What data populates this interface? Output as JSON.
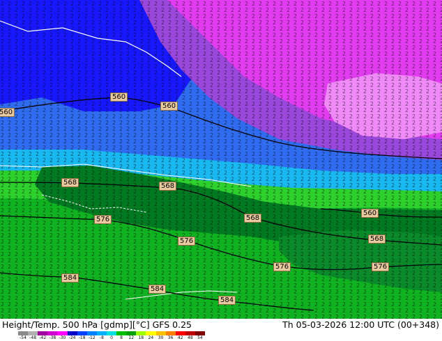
{
  "footer": {
    "title": "Height/Temp. 500 hPa [gdmp][°C] GFS 0.25",
    "datetime": "Th 05-03-2026 12:00 UTC (00+348)"
  },
  "colorbar": {
    "ticks": [
      "-54",
      "-48",
      "-42",
      "-38",
      "-30",
      "-24",
      "-18",
      "-12",
      "-8",
      "0",
      "8",
      "12",
      "18",
      "24",
      "30",
      "36",
      "42",
      "48",
      "54"
    ],
    "colors": [
      "#8a8a8a",
      "#b0b0b0",
      "#a000a0",
      "#d000d0",
      "#ff00ff",
      "#0000c8",
      "#0040ff",
      "#0080ff",
      "#00b0ff",
      "#00e0e0",
      "#00c000",
      "#00a000",
      "#a0ff00",
      "#ffff00",
      "#ffc000",
      "#ff8000",
      "#ff0000",
      "#c00000",
      "#800000"
    ]
  },
  "contour_labels": [
    "560",
    "560",
    "560",
    "568",
    "568",
    "576",
    "568",
    "568",
    "560",
    "576",
    "584",
    "584",
    "576",
    "576",
    "584"
  ],
  "colors": {
    "magenta": "#e040f0",
    "violet": "#a050e0",
    "blue_dark": "#1a1aff",
    "blue": "#3a6af0",
    "cyan": "#20c0f0",
    "green_dark": "#007a20",
    "green": "#10b020",
    "green_light": "#30d830"
  }
}
